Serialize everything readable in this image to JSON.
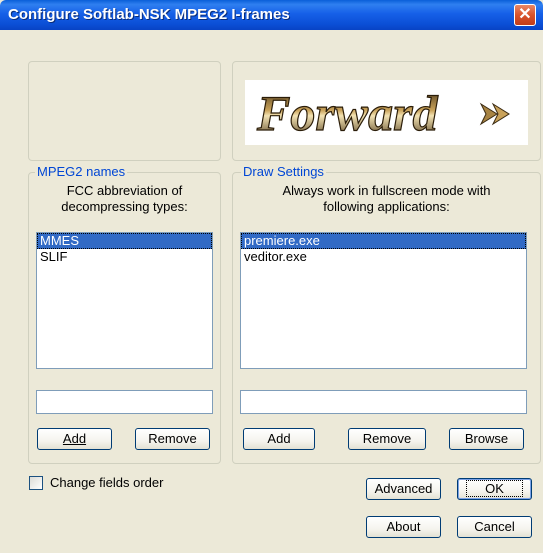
{
  "window": {
    "title": "Configure Softlab-NSK MPEG2 I-frames",
    "close_label": "✕"
  },
  "logo": {
    "text": "Forward",
    "icon": "double-arrow-icon"
  },
  "mpeg2": {
    "group_label": "MPEG2 names",
    "description_line1": "FCC abbreviation of",
    "description_line2": "decompressing types:",
    "items": [
      "MMES",
      "SLIF"
    ],
    "selected_index": 0,
    "input_value": "",
    "add_label": "Add",
    "remove_label": "Remove"
  },
  "draw": {
    "group_label": "Draw Settings",
    "description_line1": "Always work in fullscreen mode with",
    "description_line2": "following applications:",
    "items": [
      "premiere.exe",
      "veditor.exe"
    ],
    "selected_index": 0,
    "input_value": "",
    "add_label": "Add",
    "remove_label": "Remove",
    "browse_label": "Browse"
  },
  "options": {
    "change_fields_order_label": "Change fields order",
    "change_fields_order_checked": false
  },
  "buttons": {
    "advanced": "Advanced",
    "ok": "OK",
    "about": "About",
    "cancel": "Cancel"
  },
  "colors": {
    "titlebar": "#0b4fd6",
    "group_label": "#0046d5",
    "selection": "#316ac5",
    "dialog_bg": "#ece9d8"
  }
}
